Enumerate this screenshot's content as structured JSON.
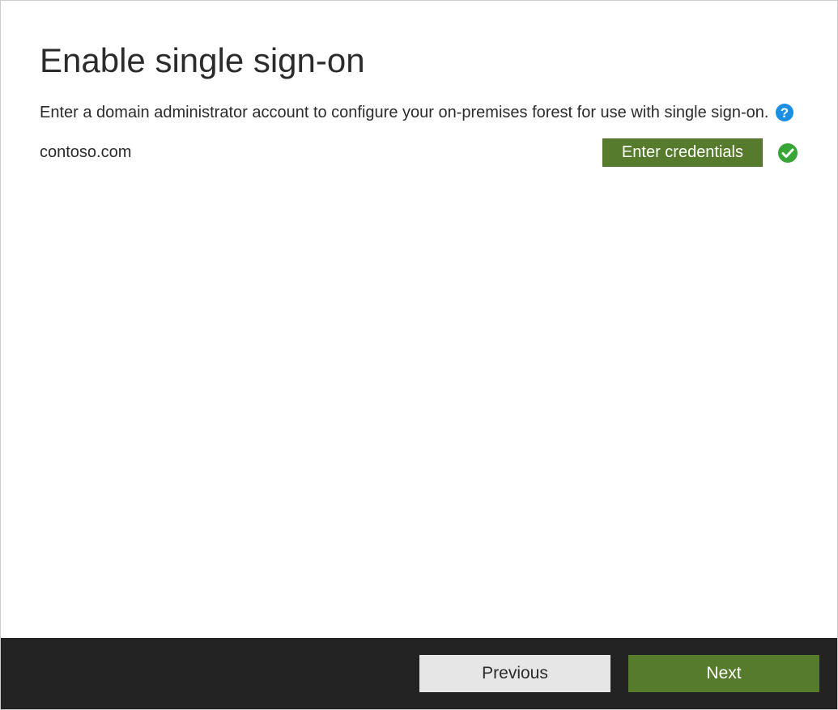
{
  "header": {
    "title": "Enable single sign-on"
  },
  "main": {
    "instruction": "Enter a domain administrator account to configure your on-premises forest for use with single sign-on.",
    "domain": "contoso.com",
    "enter_credentials_label": "Enter credentials"
  },
  "footer": {
    "previous_label": "Previous",
    "next_label": "Next"
  },
  "colors": {
    "accent_green": "#567b2c",
    "success_green": "#3aa537",
    "help_blue": "#1a8fe3",
    "footer_bg": "#232323",
    "previous_bg": "#e6e6e6"
  }
}
